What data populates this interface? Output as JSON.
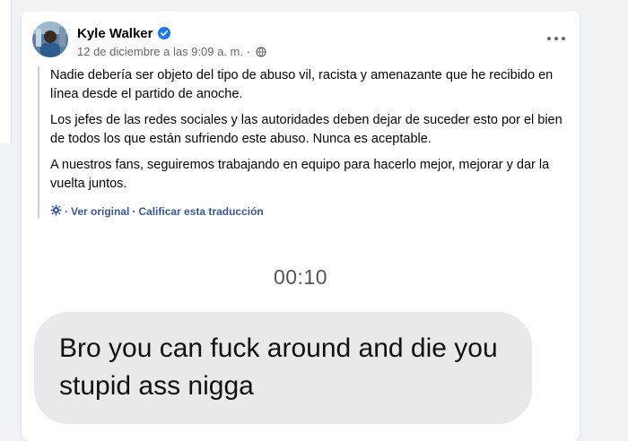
{
  "post": {
    "author": "Kyle Walker",
    "timestamp": "12 de diciembre a las 9:09 a. m.",
    "separator": "·",
    "more_label": "Más opciones"
  },
  "translation": {
    "paragraphs": [
      "Nadie debería ser objeto del tipo de abuso vil, racista y amenazante que he recibido en línea desde el partido de anoche.",
      "Los jefes de las redes sociales y las autoridades deben dejar de suceder esto por el bien de todos los que están sufriendo este abuso. Nunca es aceptable.",
      "A nuestros fans, seguiremos trabajando en equipo para hacerlo mejor, mejorar y dar la vuelta juntos."
    ],
    "see_original": "Ver original",
    "link_separator": "·",
    "rate_translation": "Calificar esta traducción"
  },
  "screenshot": {
    "timer": "00:10",
    "message": "Bro you can fuck around and die you stupid ass nigga"
  },
  "colors": {
    "verified": "#1877f2",
    "link": "#385898",
    "bubble": "#e9e9eb"
  },
  "icons": [
    "verified-badge-icon",
    "globe-icon",
    "more-dots-icon",
    "gear-icon"
  ]
}
